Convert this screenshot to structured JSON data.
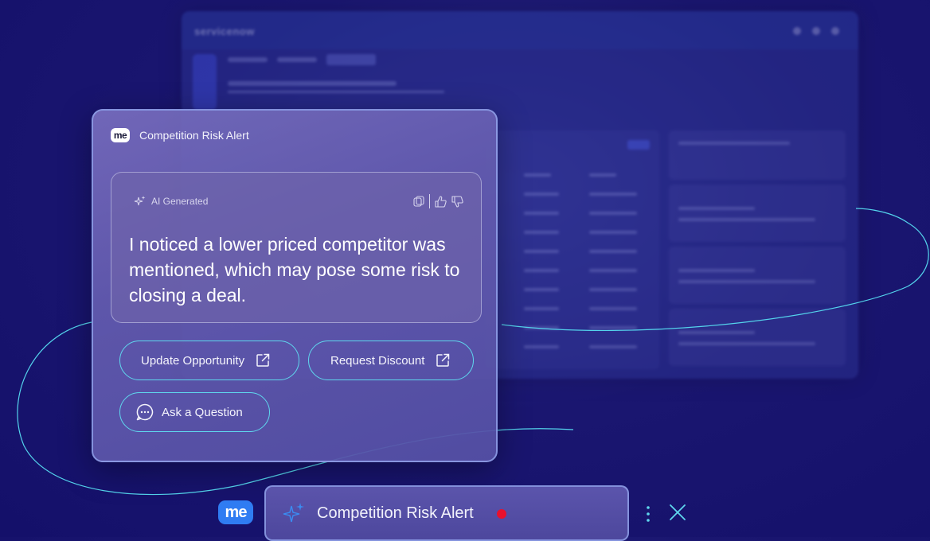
{
  "background_app": {
    "logo": "servicenow"
  },
  "card": {
    "title": "Competition Risk Alert",
    "logo_text": "me",
    "ai_label": "AI Generated",
    "message": "I noticed a lower priced competitor was mentioned, which may pose some risk to closing a deal.",
    "buttons": {
      "update_opportunity": "Update Opportunity",
      "request_discount": "Request Discount",
      "ask_question": "Ask a Question"
    }
  },
  "bottom_bar": {
    "logo_text": "me",
    "title": "Competition Risk Alert"
  },
  "colors": {
    "accent_cyan": "#5fd7ee",
    "status_red": "#e8112d",
    "brand_blue": "#2f7cf2"
  }
}
